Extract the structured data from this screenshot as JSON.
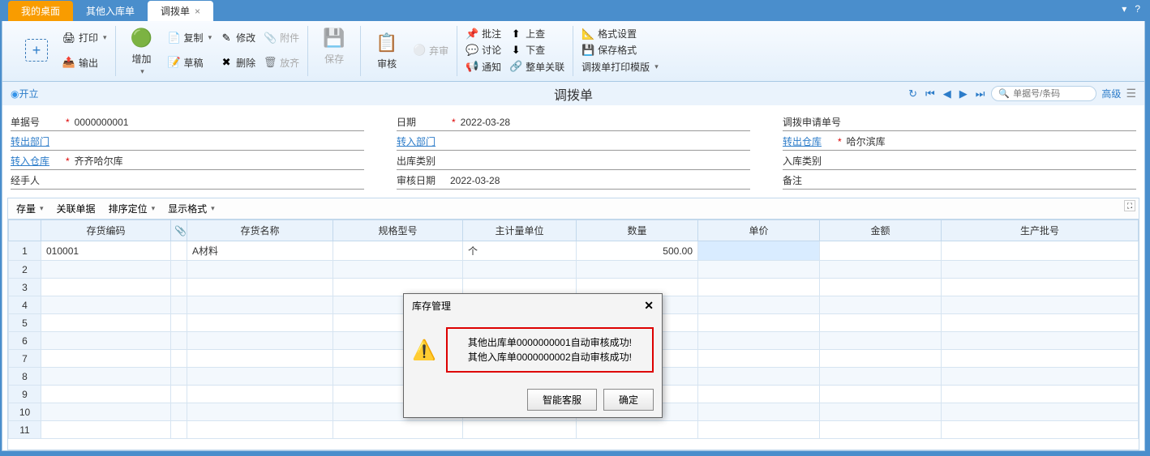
{
  "tabs": {
    "desktop": "我的桌面",
    "other_in": "其他入库单",
    "transfer": "调拨单"
  },
  "ribbon": {
    "print": "打印",
    "output": "输出",
    "add": "增加",
    "copy": "复制",
    "draft": "草稿",
    "modify": "修改",
    "delete": "删除",
    "attachment": "附件",
    "discard": "放齐",
    "save": "保存",
    "audit": "审核",
    "abandon": "弃审",
    "batch_note": "批注",
    "discuss": "讨论",
    "notify": "通知",
    "check_up": "上查",
    "check_down": "下查",
    "doc_link": "整单关联",
    "format_set": "格式设置",
    "save_format": "保存格式",
    "print_template": "调拨单打印模版"
  },
  "header": {
    "status": "开立",
    "title": "调拨单",
    "search_placeholder": "单据号/条码",
    "advanced": "高级"
  },
  "form": {
    "doc_no_label": "单据号",
    "doc_no": "0000000001",
    "date_label": "日期",
    "date": "2022-03-28",
    "request_no_label": "调拨申请单号",
    "request_no": "",
    "out_dept_label": "转出部门",
    "out_dept": "",
    "in_dept_label": "转入部门",
    "in_dept": "",
    "out_wh_label": "转出仓库",
    "out_wh": "哈尔滨库",
    "in_wh_label": "转入仓库",
    "in_wh": "齐齐哈尔库",
    "out_type_label": "出库类别",
    "out_type": "",
    "in_type_label": "入库类别",
    "in_type": "",
    "handler_label": "经手人",
    "handler": "",
    "audit_date_label": "审核日期",
    "audit_date": "2022-03-28",
    "remark_label": "备注",
    "remark": ""
  },
  "toolbar": {
    "stock": "存量",
    "related": "关联单据",
    "sort": "排序定位",
    "display": "显示格式"
  },
  "grid": {
    "cols": {
      "code": "存货编码",
      "name": "存货名称",
      "spec": "规格型号",
      "unit": "主计量单位",
      "qty": "数量",
      "price": "单价",
      "amount": "金额",
      "batch": "生产批号"
    },
    "r1_code": "010001",
    "r1_name": "A材料",
    "r1_unit": "个",
    "r1_qty": "500.00"
  },
  "dialog": {
    "title": "库存管理",
    "msg1": "其他出库单0000000001自动审核成功!",
    "msg2": "其他入库单0000000002自动审核成功!",
    "smart": "智能客服",
    "ok": "确定"
  }
}
